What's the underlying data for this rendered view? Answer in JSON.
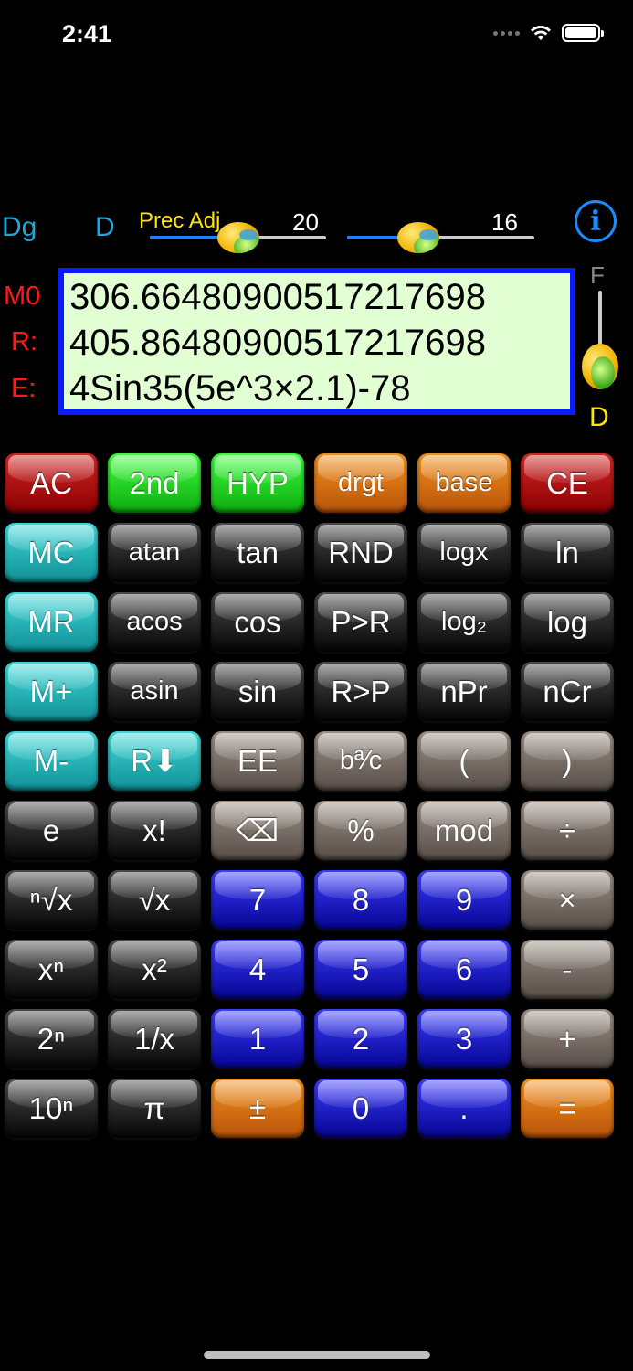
{
  "status": {
    "time": "2:41"
  },
  "modes": {
    "angle": "Dg",
    "format": "D"
  },
  "sliders": {
    "prec_label": "Prec Adj",
    "precision_value": "20",
    "digits_value": "16",
    "precision_fraction": 0.5,
    "digits_fraction": 0.38
  },
  "display": {
    "memory_label": "M0",
    "result_label": "R:",
    "expr_label": "E:",
    "memory_value": "306.66480900517217698",
    "result_value": "405.86480900517217698",
    "expression": "4Sin35(5e^3×2.1)-78"
  },
  "vertical_slider": {
    "top_label": "F",
    "bottom_label": "D"
  },
  "keys": [
    {
      "label": "AC",
      "color": "red"
    },
    {
      "label": "2nd",
      "color": "green"
    },
    {
      "label": "HYP",
      "color": "green"
    },
    {
      "label": "drgt",
      "color": "orange"
    },
    {
      "label": "base",
      "color": "orange"
    },
    {
      "label": "CE",
      "color": "red"
    },
    {
      "label": "MC",
      "color": "teal"
    },
    {
      "label": "atan",
      "color": "black"
    },
    {
      "label": "tan",
      "color": "black"
    },
    {
      "label": "RND",
      "color": "black"
    },
    {
      "label": "logx",
      "color": "black"
    },
    {
      "label": "ln",
      "color": "black"
    },
    {
      "label": "MR",
      "color": "teal"
    },
    {
      "label": "acos",
      "color": "black"
    },
    {
      "label": "cos",
      "color": "black"
    },
    {
      "label": "P>R",
      "color": "black"
    },
    {
      "label": "log₂",
      "color": "black"
    },
    {
      "label": "log",
      "color": "black"
    },
    {
      "label": "M+",
      "color": "teal"
    },
    {
      "label": "asin",
      "color": "black"
    },
    {
      "label": "sin",
      "color": "black"
    },
    {
      "label": "R>P",
      "color": "black"
    },
    {
      "label": "nPr",
      "color": "black"
    },
    {
      "label": "nCr",
      "color": "black"
    },
    {
      "label": "M-",
      "color": "teal"
    },
    {
      "label": "R⬇",
      "color": "teal"
    },
    {
      "label": "EE",
      "color": "gray"
    },
    {
      "label": "bª⁄c",
      "color": "gray"
    },
    {
      "label": "(",
      "color": "gray"
    },
    {
      "label": ")",
      "color": "gray"
    },
    {
      "label": "e",
      "color": "black"
    },
    {
      "label": "x!",
      "color": "black"
    },
    {
      "label": "⌫",
      "color": "gray"
    },
    {
      "label": "%",
      "color": "gray"
    },
    {
      "label": "mod",
      "color": "gray"
    },
    {
      "label": "÷",
      "color": "gray"
    },
    {
      "label": "ⁿ√x",
      "color": "black"
    },
    {
      "label": "√x",
      "color": "black"
    },
    {
      "label": "7",
      "color": "blue"
    },
    {
      "label": "8",
      "color": "blue"
    },
    {
      "label": "9",
      "color": "blue"
    },
    {
      "label": "×",
      "color": "gray"
    },
    {
      "label": "xⁿ",
      "color": "black"
    },
    {
      "label": "x²",
      "color": "black"
    },
    {
      "label": "4",
      "color": "blue"
    },
    {
      "label": "5",
      "color": "blue"
    },
    {
      "label": "6",
      "color": "blue"
    },
    {
      "label": "-",
      "color": "gray"
    },
    {
      "label": "2ⁿ",
      "color": "black"
    },
    {
      "label": "1/x",
      "color": "black"
    },
    {
      "label": "1",
      "color": "blue"
    },
    {
      "label": "2",
      "color": "blue"
    },
    {
      "label": "3",
      "color": "blue"
    },
    {
      "label": "+",
      "color": "gray"
    },
    {
      "label": "10ⁿ",
      "color": "black"
    },
    {
      "label": "π",
      "color": "black"
    },
    {
      "label": "±",
      "color": "orange"
    },
    {
      "label": "0",
      "color": "blue"
    },
    {
      "label": ".",
      "color": "blue"
    },
    {
      "label": "=",
      "color": "orange"
    }
  ]
}
